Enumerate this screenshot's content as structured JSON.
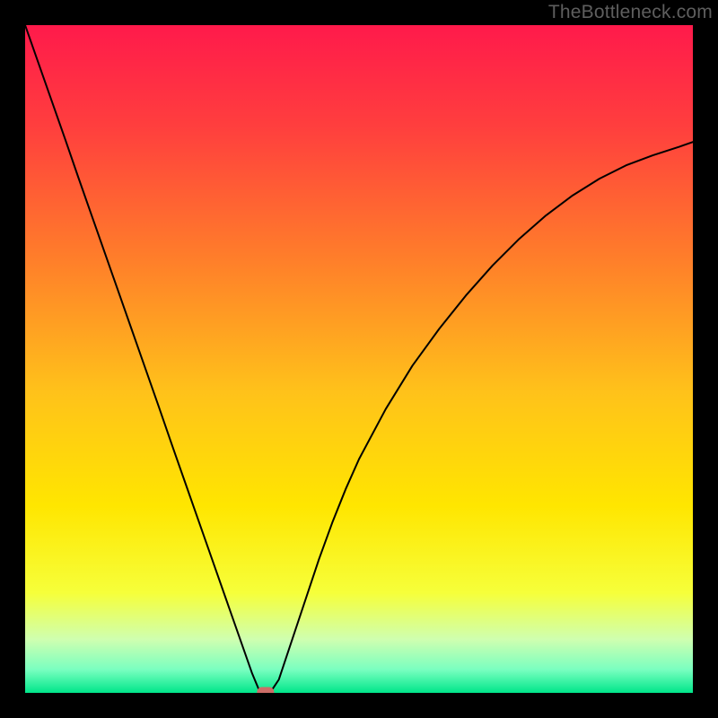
{
  "watermark": "TheBottleneck.com",
  "colors": {
    "page_bg": "#000000",
    "curve": "#000000",
    "marker": "#cc6d67",
    "gradient_stops": [
      {
        "offset": 0.0,
        "color": "#ff1a4b"
      },
      {
        "offset": 0.15,
        "color": "#ff3e3e"
      },
      {
        "offset": 0.35,
        "color": "#ff7e2a"
      },
      {
        "offset": 0.55,
        "color": "#ffc21a"
      },
      {
        "offset": 0.72,
        "color": "#ffe600"
      },
      {
        "offset": 0.85,
        "color": "#f6ff3a"
      },
      {
        "offset": 0.92,
        "color": "#cfffb0"
      },
      {
        "offset": 0.965,
        "color": "#7affc0"
      },
      {
        "offset": 1.0,
        "color": "#00e68a"
      }
    ]
  },
  "chart_data": {
    "type": "line",
    "title": "",
    "xlabel": "",
    "ylabel": "",
    "xlim": [
      0,
      100
    ],
    "ylim": [
      0,
      100
    ],
    "x": [
      0,
      2,
      4,
      6,
      8,
      10,
      12,
      14,
      16,
      18,
      20,
      22,
      24,
      26,
      28,
      30,
      32,
      34,
      35,
      36,
      37,
      38,
      40,
      42,
      44,
      46,
      48,
      50,
      54,
      58,
      62,
      66,
      70,
      74,
      78,
      82,
      86,
      90,
      94,
      98,
      100
    ],
    "values": [
      100,
      94.3,
      88.6,
      82.9,
      77.1,
      71.4,
      65.7,
      60.0,
      54.3,
      48.6,
      42.9,
      37.1,
      31.4,
      25.7,
      20.0,
      14.3,
      8.6,
      2.9,
      0.5,
      0.0,
      0.5,
      2.0,
      8.0,
      14.0,
      20.0,
      25.5,
      30.5,
      35.0,
      42.5,
      49.0,
      54.5,
      59.5,
      64.0,
      68.0,
      71.5,
      74.5,
      77.0,
      79.0,
      80.5,
      81.8,
      82.5
    ],
    "marker": {
      "x": 36,
      "y": 0
    },
    "legend": [],
    "grid": false
  }
}
